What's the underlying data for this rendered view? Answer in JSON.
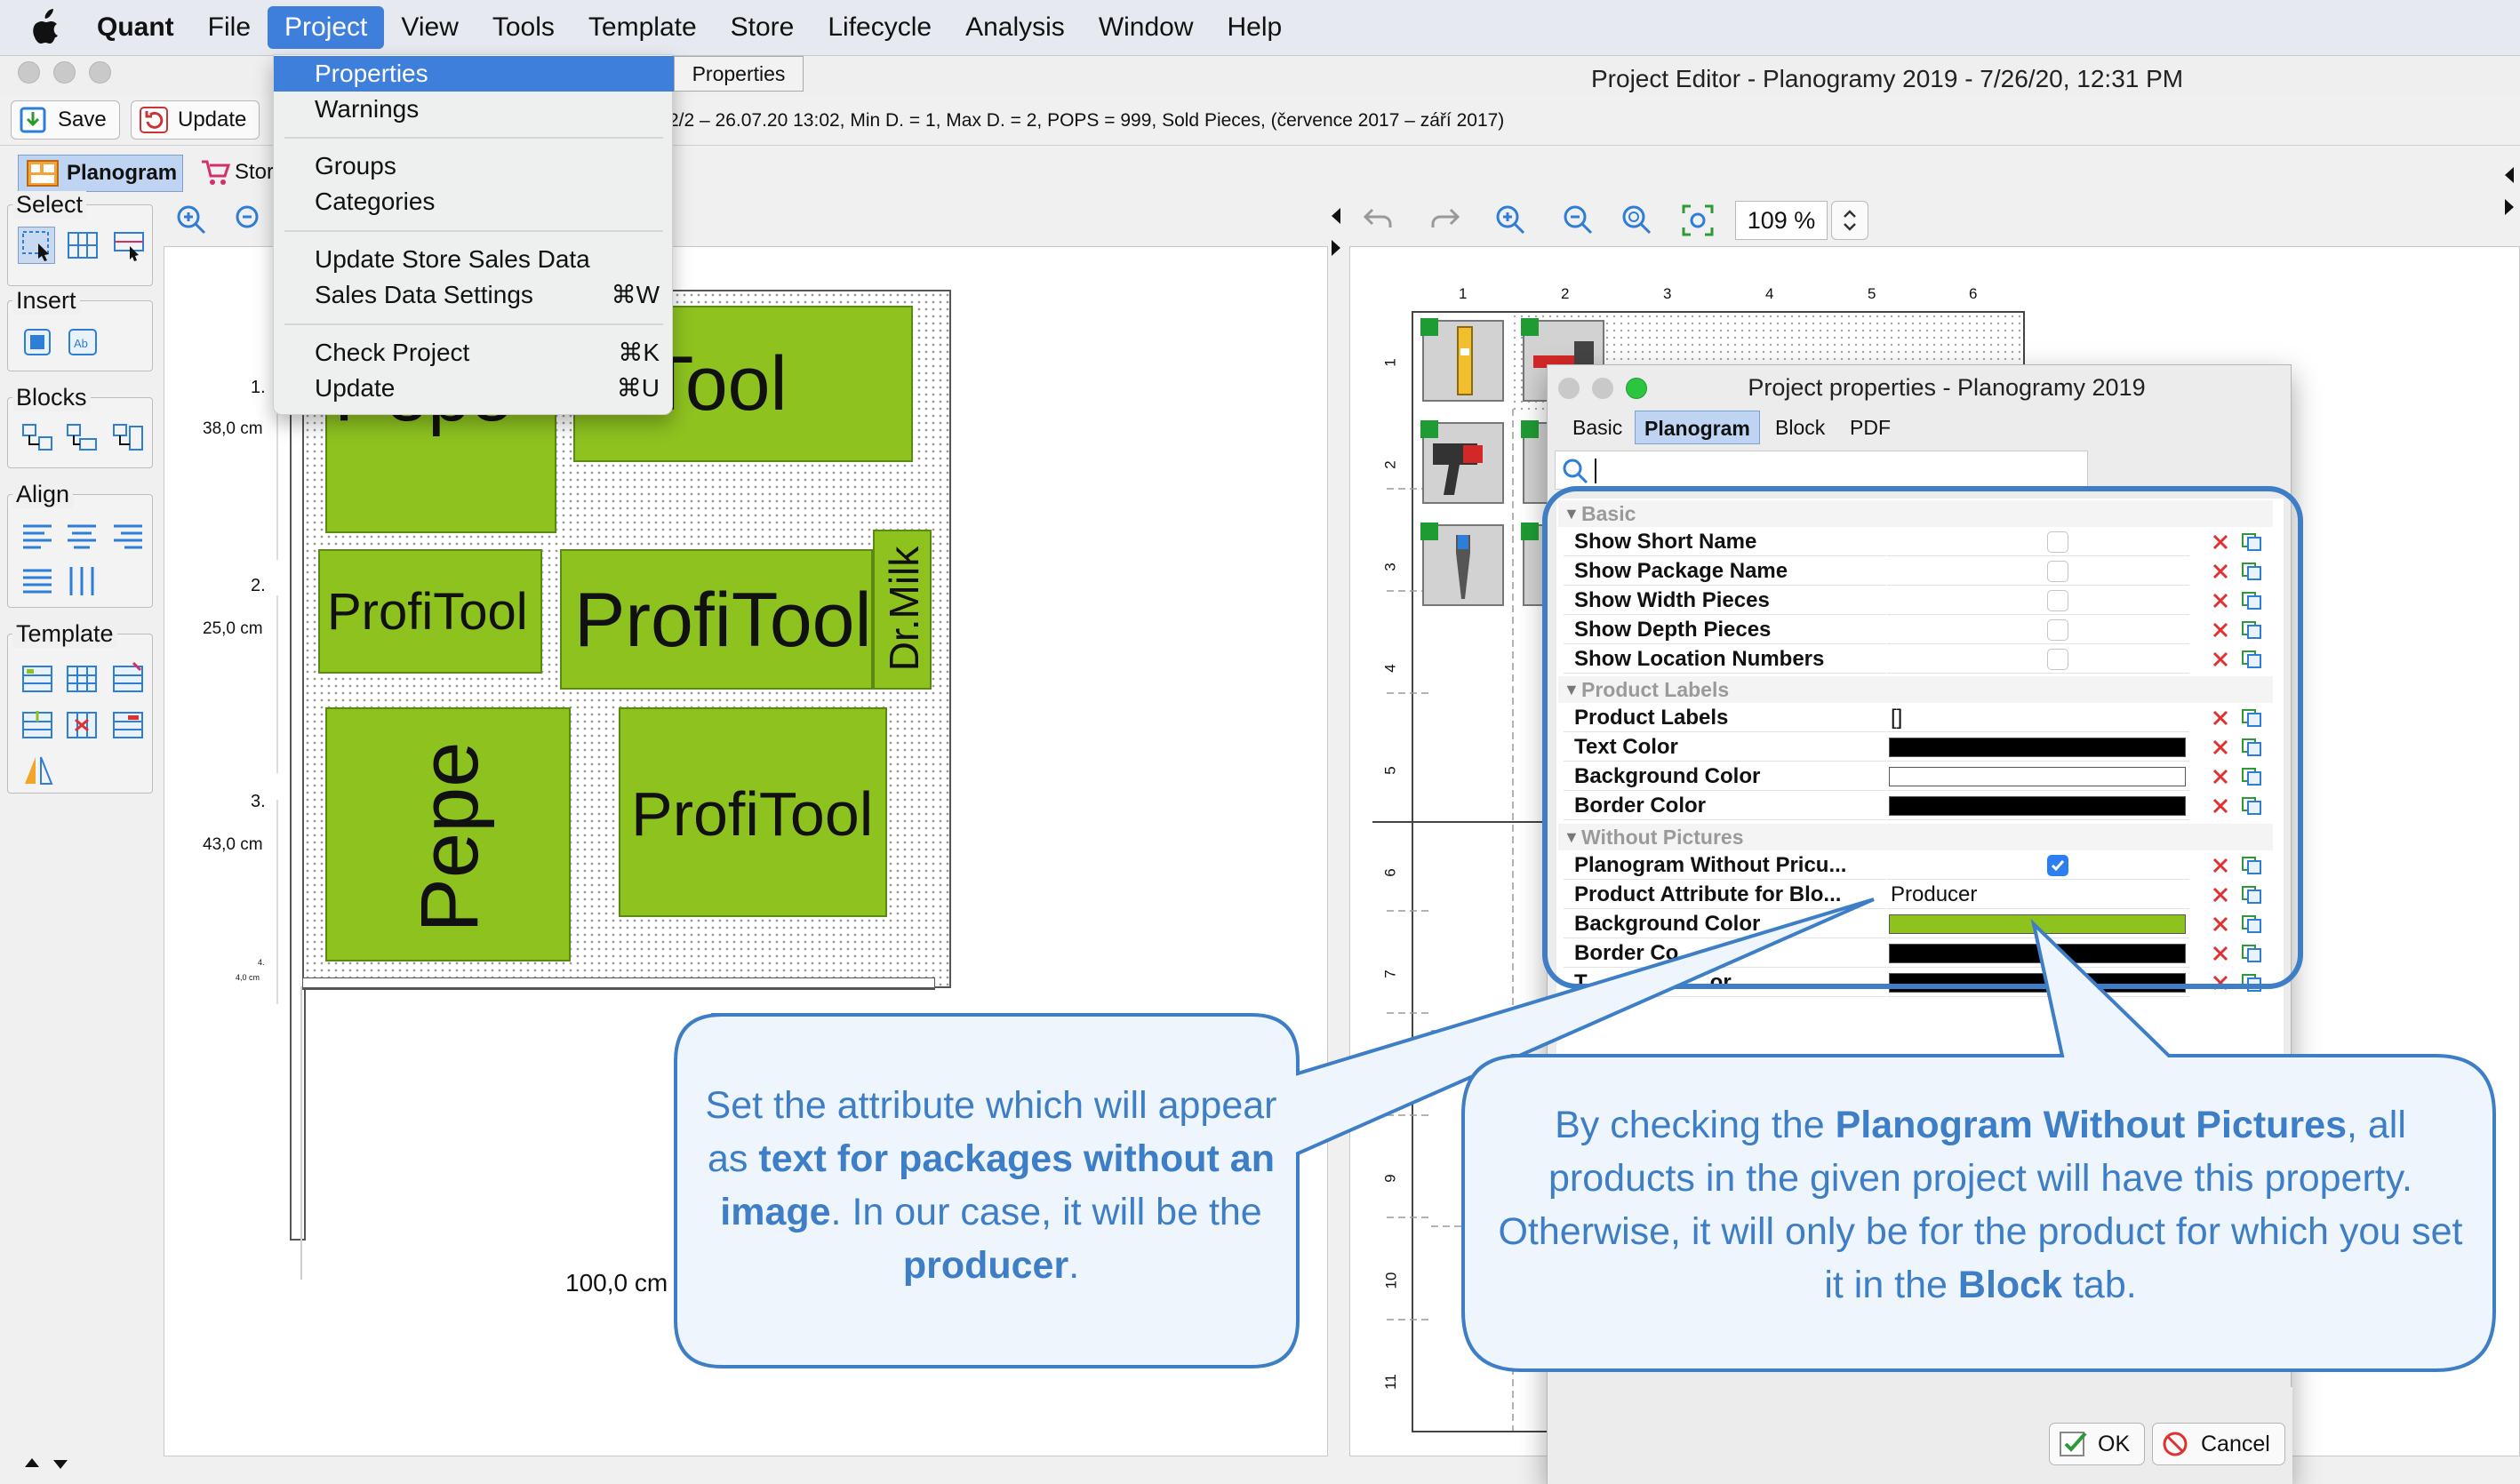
{
  "menubar": {
    "app": "Quant",
    "items": [
      "File",
      "Project",
      "View",
      "Tools",
      "Template",
      "Store",
      "Lifecycle",
      "Analysis",
      "Window",
      "Help"
    ]
  },
  "window": {
    "title": "Project Editor - Planogramy 2019 - 7/26/20, 12:31 PM"
  },
  "toolbar": {
    "save_label": "Save",
    "update_label": "Update",
    "project_info": "2/2 – 26.07.20 13:02, Min D. = 1, Max D. = 2, POPS = 999, Sold Pieces, (července 2017 – září 2017)"
  },
  "view_tabs": {
    "planogram": "Planogram",
    "store": "Stor"
  },
  "left_panel": {
    "groups": {
      "select": "Select",
      "insert": "Insert",
      "blocks": "Blocks",
      "align": "Align",
      "template": "Template"
    }
  },
  "project_menu": {
    "items": [
      {
        "label": "Properties",
        "shortcut": ""
      },
      {
        "label": "Warnings",
        "shortcut": ""
      },
      {
        "label": "Groups",
        "shortcut": ""
      },
      {
        "label": "Categories",
        "shortcut": ""
      },
      {
        "label": "Update Store Sales Data",
        "shortcut": ""
      },
      {
        "label": "Sales Data Settings",
        "shortcut": "⌘W"
      },
      {
        "label": "Check Project",
        "shortcut": "⌘K"
      },
      {
        "label": "Update",
        "shortcut": "⌘U"
      }
    ],
    "tooltip": "Properties"
  },
  "left_planogram": {
    "shelves": [
      {
        "num": "1.",
        "height": "38,0 cm"
      },
      {
        "num": "2.",
        "height": "25,0 cm"
      },
      {
        "num": "3.",
        "height": "43,0 cm"
      },
      {
        "num": "4.",
        "height": "4,0 cm"
      }
    ],
    "width_label": "100,0 cm",
    "blocks": [
      "Pepe",
      "ProfiTool",
      "ProfiTool",
      "ProfiTool",
      "Dr.Milk",
      "Pepe",
      "ProfiTool"
    ]
  },
  "right_toolbar": {
    "zoom": "109 %"
  },
  "right_planogram": {
    "columns": [
      "1",
      "2",
      "3",
      "4",
      "5",
      "6"
    ],
    "rows": [
      "1",
      "2",
      "3",
      "4",
      "5",
      "6",
      "7",
      "8",
      "9",
      "10",
      "11"
    ]
  },
  "dialog": {
    "title": "Project properties - Planogramy 2019",
    "tabs": [
      "Basic",
      "Planogram",
      "Block",
      "PDF"
    ],
    "active_tab": "Planogram",
    "sections": {
      "basic": "Basic",
      "product_labels": "Product Labels",
      "without_pictures": "Without Pictures"
    },
    "rows": {
      "show_short_name": {
        "label": "Show Short Name",
        "checked": false
      },
      "show_package_name": {
        "label": "Show Package Name",
        "checked": false
      },
      "show_width_pieces": {
        "label": "Show Width Pieces",
        "checked": false
      },
      "show_depth_pieces": {
        "label": "Show Depth Pieces",
        "checked": false
      },
      "show_location_numbers": {
        "label": "Show Location Numbers",
        "checked": false
      },
      "product_labels": {
        "label": "Product Labels",
        "value": "[]"
      },
      "text_color": {
        "label": "Text Color",
        "color": "#000000"
      },
      "background_color": {
        "label": "Background Color",
        "color": "#ffffff"
      },
      "border_color": {
        "label": "Border Color",
        "color": "#000000"
      },
      "planogram_without_pictures": {
        "label": "Planogram Without Pricu...",
        "checked": true
      },
      "product_attribute_for_blocks": {
        "label": "Product Attribute for Blo...",
        "value": "Producer"
      },
      "wp_background_color": {
        "label": "Background Color",
        "color": "#8dc21f"
      },
      "wp_border_color": {
        "label": "Border Co",
        "color": "#000000"
      },
      "wp_text_color": {
        "label": "T",
        "tail": "or",
        "color": "#000000"
      }
    },
    "ok_label": "OK",
    "cancel_label": "Cancel"
  },
  "callouts": {
    "left": {
      "t1": "Set the attribute which will appear as ",
      "b1": "text for packages without an image",
      "t2": ". In our case, it will be the ",
      "b2": "producer",
      "t3": "."
    },
    "right": {
      "t1": "By checking the ",
      "b1": "Planogram Without Pictures",
      "t2": ", all products in the given project will have this property. Otherwise, it will only be for the product for which you set it in the ",
      "b2": "Block",
      "t3": " tab."
    }
  },
  "colors": {
    "accent": "#3f7fdc",
    "block_green": "#8dc21f",
    "callout_blue": "#3d7ec6",
    "delete_red": "#e03030"
  }
}
